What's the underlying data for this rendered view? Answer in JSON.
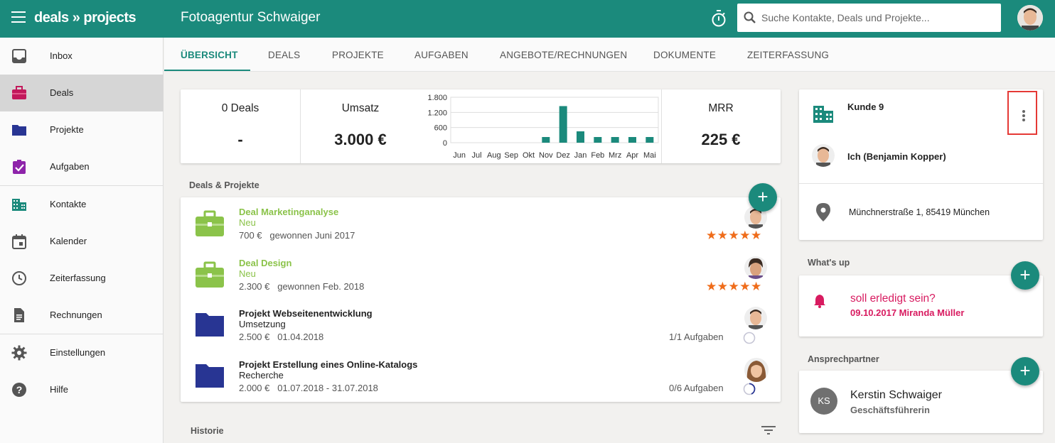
{
  "app": {
    "logo": "deals » projects",
    "title": "Fotoagentur Schwaiger"
  },
  "search": {
    "placeholder": "Suche Kontakte, Deals und Projekte..."
  },
  "sidebar": {
    "items": [
      {
        "label": "Inbox",
        "icon": "inbox-icon"
      },
      {
        "label": "Deals",
        "icon": "briefcase-icon"
      },
      {
        "label": "Projekte",
        "icon": "folder-icon"
      },
      {
        "label": "Aufgaben",
        "icon": "clipboard-check-icon"
      },
      {
        "label": "Kontakte",
        "icon": "building-icon"
      },
      {
        "label": "Kalender",
        "icon": "calendar-icon"
      },
      {
        "label": "Zeiterfassung",
        "icon": "clock-icon"
      },
      {
        "label": "Rechnungen",
        "icon": "document-icon"
      },
      {
        "label": "Einstellungen",
        "icon": "gear-icon"
      },
      {
        "label": "Hilfe",
        "icon": "help-icon"
      }
    ]
  },
  "tabs": [
    "ÜBERSICHT",
    "DEALS",
    "PROJEKTE",
    "AUFGABEN",
    "ANGEBOTE/RECHNUNGEN",
    "DOKUMENTE",
    "ZEITERFASSUNG"
  ],
  "stats": {
    "deals": {
      "title": "0 Deals",
      "value": "-"
    },
    "umsatz": {
      "title": "Umsatz",
      "value": "3.000 €"
    },
    "mrr": {
      "title": "MRR",
      "value": "225 €"
    }
  },
  "chart_data": {
    "type": "bar",
    "categories": [
      "Jun",
      "Jul",
      "Aug",
      "Sep",
      "Okt",
      "Nov",
      "Dez",
      "Jan",
      "Feb",
      "Mrz",
      "Apr",
      "Mai"
    ],
    "values": [
      0,
      0,
      0,
      0,
      0,
      225,
      1450,
      450,
      225,
      225,
      225,
      225
    ],
    "yticks": [
      "1.800",
      "1.200",
      "600",
      "0"
    ],
    "ylim": [
      0,
      1800
    ],
    "grid": true,
    "color": "#1b8a7c"
  },
  "deals_projects": {
    "heading": "Deals & Projekte",
    "items": [
      {
        "title": "Deal Marketinganalyse",
        "status": "Neu",
        "amount": "700 €",
        "info": "gewonnen Juni 2017",
        "stars": "★★★★★"
      },
      {
        "title": "Deal Design",
        "status": "Neu",
        "amount": "2.300 €",
        "info": "gewonnen Feb. 2018",
        "stars": "★★★★★"
      },
      {
        "title": "Projekt Webseitenentwicklung",
        "status": "Umsetzung",
        "amount": "2.500 €",
        "info": "01.04.2018",
        "tasks": "1/1 Aufgaben"
      },
      {
        "title": "Projekt Erstellung eines Online-Katalogs",
        "status": "Recherche",
        "amount": "2.000 €",
        "info": "01.07.2018 - 31.07.2018",
        "tasks": "0/6 Aufgaben"
      }
    ]
  },
  "historie": {
    "heading": "Historie"
  },
  "customer": {
    "name": "Kunde 9",
    "owner": "Ich (Benjamin Kopper)",
    "address": "Münchnerstraße 1, 85419 München"
  },
  "whatsup": {
    "heading": "What's up",
    "text": "soll erledigt sein?",
    "date": "09.10.2017 Miranda Müller"
  },
  "contacts": {
    "heading": "Ansprechpartner",
    "name": "Kerstin Schwaiger",
    "role": "Geschäftsführerin",
    "initials": "KS"
  },
  "colors": {
    "primary": "#1b8a7c",
    "deal_green": "#8bc34a",
    "folder_blue": "#283593",
    "star": "#ef6c1a",
    "alert_red": "#d81b60"
  }
}
